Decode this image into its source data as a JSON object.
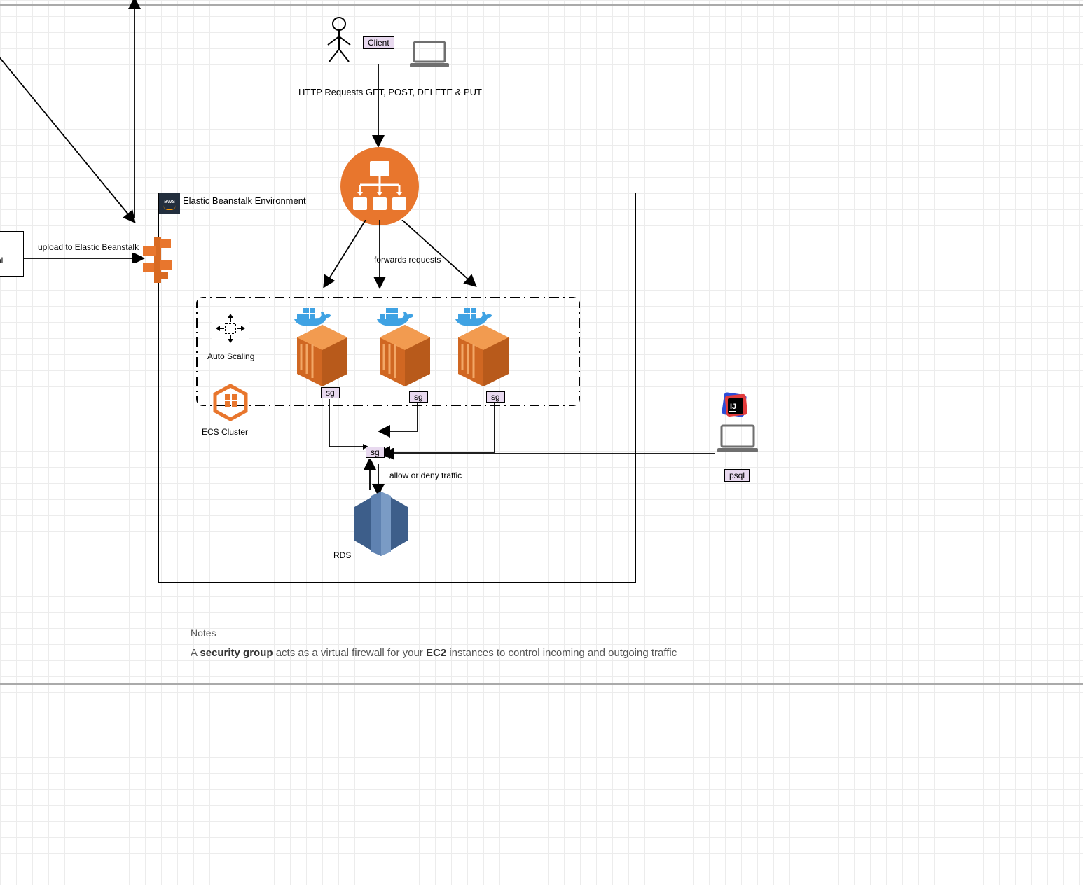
{
  "client": {
    "box_label": "Client"
  },
  "http_line": "HTTP Requests GET, POST, DELETE & PUT",
  "region": {
    "title": "Elastic Beanstalk Environment",
    "badge": "aws"
  },
  "file": {
    "name": "yaml"
  },
  "upload_edge": "upload to Elastic Beanstalk",
  "lb_forward": "forwards requests",
  "autoscaling": {
    "label": "Auto Scaling"
  },
  "ecs": {
    "label": "ECS Cluster"
  },
  "sg": {
    "instance1": "sg",
    "instance2": "sg",
    "instance3": "sg",
    "db": "sg",
    "caption": "allow or deny traffic"
  },
  "rds": {
    "label": "RDS"
  },
  "psql": {
    "label": "psql"
  },
  "notes": {
    "title": "Notes",
    "body_prefix": "A ",
    "body_b1": "security group",
    "body_mid": " acts as a virtual firewall for your ",
    "body_b2": "EC2",
    "body_suffix": " instances to control incoming and outgoing traffic"
  },
  "colors": {
    "aws_orange": "#e8762d",
    "docker_blue": "#3fa2e3",
    "rds_blue1": "#3d5e8a",
    "rds_blue2": "#5f82b1",
    "rds_blue3": "#7a9bc5",
    "intellij_red": "#e33b3b",
    "intellij_blue": "#2b4cd8",
    "lavender": "#e8d9ef"
  }
}
